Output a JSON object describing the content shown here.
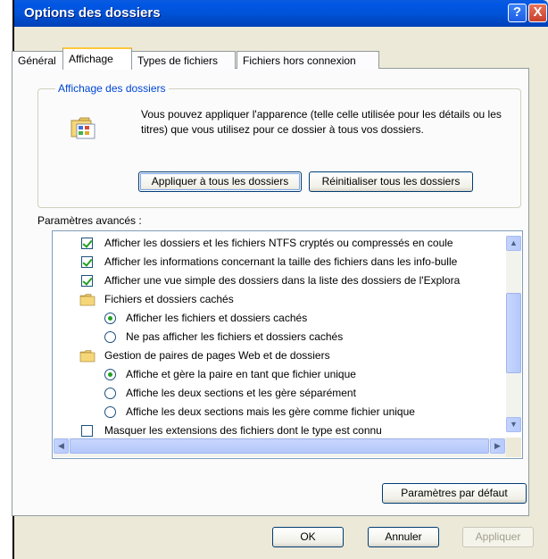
{
  "window": {
    "title": "Options des dossiers",
    "help_icon": "?",
    "close_icon": "X"
  },
  "tabs": [
    {
      "label": "Général",
      "active": false
    },
    {
      "label": "Affichage",
      "active": true
    },
    {
      "label": "Types de fichiers",
      "active": false
    },
    {
      "label": "Fichiers hors connexion",
      "active": false
    }
  ],
  "folder_view": {
    "group_title": "Affichage des dossiers",
    "description": "Vous pouvez appliquer l'apparence (telle celle utilisée pour les détails ou les titres) que vous utilisez pour ce dossier à tous vos dossiers.",
    "apply_all_label": "Appliquer à tous les dossiers",
    "reset_all_label": "Réinitialiser tous les dossiers"
  },
  "advanced": {
    "label": "Paramètres avancés :",
    "items": [
      {
        "type": "checkbox",
        "checked": true,
        "indent": 0,
        "label": "Afficher les dossiers et les fichiers NTFS cryptés ou compressés en coule"
      },
      {
        "type": "checkbox",
        "checked": true,
        "indent": 0,
        "label": "Afficher les informations concernant la taille des fichiers dans les info-bulle"
      },
      {
        "type": "checkbox",
        "checked": true,
        "indent": 0,
        "label": "Afficher une vue simple des dossiers dans la liste des dossiers de l'Explora"
      },
      {
        "type": "folder",
        "indent": 0,
        "label": "Fichiers et dossiers cachés"
      },
      {
        "type": "radio",
        "checked": true,
        "indent": 1,
        "label": "Afficher les fichiers et dossiers cachés"
      },
      {
        "type": "radio",
        "checked": false,
        "indent": 1,
        "label": "Ne pas afficher les fichiers et dossiers cachés"
      },
      {
        "type": "folder",
        "indent": 0,
        "label": "Gestion de paires de pages Web et de dossiers"
      },
      {
        "type": "radio",
        "checked": true,
        "indent": 1,
        "label": "Affiche et gère la paire en tant que fichier unique"
      },
      {
        "type": "radio",
        "checked": false,
        "indent": 1,
        "label": "Affiche les deux sections et les gère séparément"
      },
      {
        "type": "radio",
        "checked": false,
        "indent": 1,
        "label": "Affiche les deux sections mais les gère comme fichier unique"
      },
      {
        "type": "checkbox",
        "checked": false,
        "indent": 0,
        "label": "Masquer les extensions des fichiers dont le type est connu"
      }
    ]
  },
  "buttons": {
    "defaults_label": "Paramètres par défaut",
    "ok_label": "OK",
    "cancel_label": "Annuler",
    "apply_label": "Appliquer"
  },
  "colors": {
    "title_bar": "#0053d7",
    "dialog_bg": "#ece9d8",
    "group_title": "#0046d5",
    "active_tab_highlight": "#ffc83c"
  }
}
